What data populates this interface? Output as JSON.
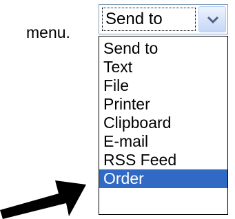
{
  "lead_text": "menu.",
  "combo": {
    "value": "Send to",
    "button_icon": "chevron-down-icon"
  },
  "dropdown": {
    "options": [
      {
        "label": "Send to",
        "selected": false
      },
      {
        "label": "Text",
        "selected": false
      },
      {
        "label": "File",
        "selected": false
      },
      {
        "label": "Printer",
        "selected": false
      },
      {
        "label": "Clipboard",
        "selected": false
      },
      {
        "label": "E-mail",
        "selected": false
      },
      {
        "label": "RSS Feed",
        "selected": false
      },
      {
        "label": "Order",
        "selected": true
      }
    ],
    "highlight_color": "#316ac5"
  },
  "pointer": {
    "icon": "arrow-icon",
    "color": "#000000"
  }
}
